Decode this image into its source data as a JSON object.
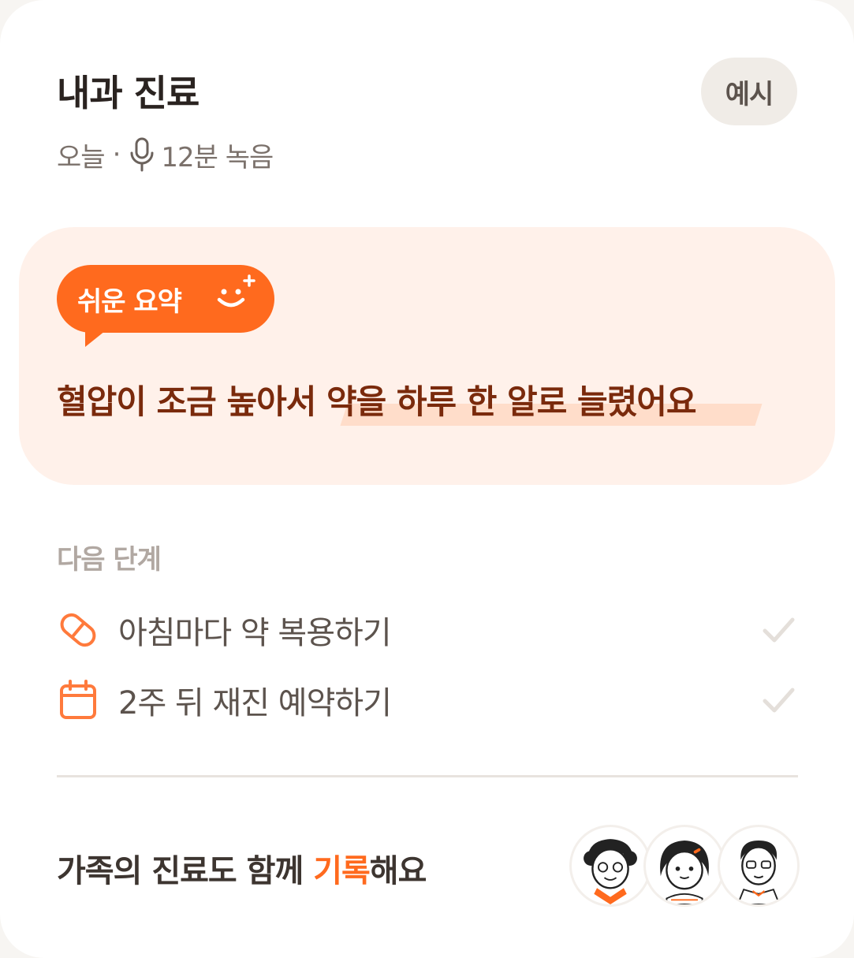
{
  "header": {
    "title": "내과 진료",
    "badge": "예시"
  },
  "meta": {
    "date": "오늘",
    "separator": "·",
    "duration": "12분 녹음",
    "mic_icon": "mic-icon"
  },
  "summary": {
    "pill_label": "쉬운 요약",
    "pill_icon": "smile-sparkle-icon",
    "text": "혈압이 조금 높아서 약을 하루 한 알로 늘렸어요"
  },
  "next_steps": {
    "label": "다음 단계",
    "items": [
      {
        "icon": "pill-icon",
        "label": "아침마다 약 복용하기",
        "status_icon": "check-icon"
      },
      {
        "icon": "calendar-icon",
        "label": "2주 뒤 재진 예약하기",
        "status_icon": "check-icon"
      }
    ]
  },
  "footer": {
    "text_before": "가족의 진료도 함께 ",
    "text_accent": "기록",
    "text_after": "해요",
    "avatars": [
      "grandmother-avatar",
      "girl-avatar",
      "father-avatar"
    ]
  },
  "colors": {
    "accent": "#ff6a1e",
    "summary_bg": "#fff1ea",
    "summary_text": "#7a2a0c",
    "muted": "#7b716b"
  }
}
